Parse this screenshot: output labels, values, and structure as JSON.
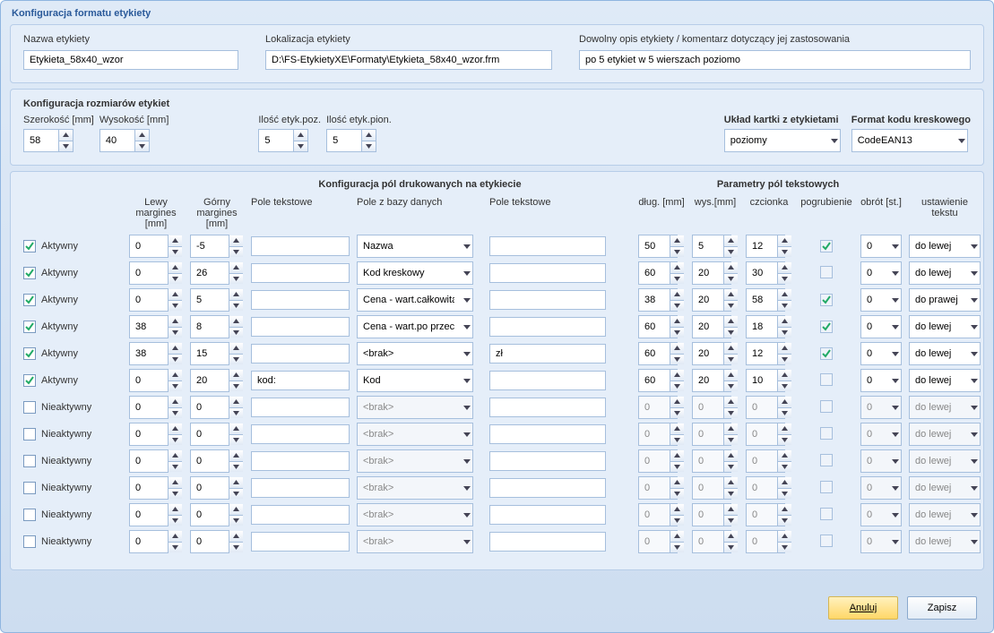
{
  "title": "Konfiguracja formatu etykiety",
  "top": {
    "name_label": "Nazwa etykiety",
    "name_value": "Etykieta_58x40_wzor",
    "loc_label": "Lokalizacja etykiety",
    "loc_value": "D:\\FS-EtykietyXE\\Formaty\\Etykieta_58x40_wzor.frm",
    "desc_label": "Dowolny opis etykiety / komentarz dotyczący jej zastosowania",
    "desc_value": "po 5 etykiet w 5 wierszach poziomo"
  },
  "sizes": {
    "section_title": "Konfiguracja rozmiarów etykiet",
    "width_label": "Szerokość [mm]",
    "width_value": "58",
    "height_label": "Wysokość [mm]",
    "height_value": "40",
    "count_h_label": "Ilość etyk.poz.",
    "count_h_value": "5",
    "count_v_label": "Ilość etyk.pion.",
    "count_v_value": "5",
    "layout_label": "Układ kartki z etykietami",
    "layout_value": "poziomy",
    "barcode_label": "Format kodu kreskowego",
    "barcode_value": "CodeEAN13"
  },
  "fields": {
    "mid_title": "Konfiguracja pól  drukowanych na etykiecie",
    "right_title": "Parametry pól tekstowych",
    "headers": {
      "empty": "",
      "left_margin": "Lewy margines [mm]",
      "top_margin": "Górny margines [mm]",
      "text_field": "Pole tekstowe",
      "db_field": "Pole z bazy danych",
      "text_field2": "Pole tekstowe",
      "length": "dług. [mm]",
      "height": "wys.[mm]",
      "font": "czcionka",
      "bold": "pogrubienie",
      "rotation": "obrót [st.]",
      "align": "ustawienie tekstu"
    },
    "active_label": "Aktywny",
    "inactive_label": "Nieaktywny",
    "rows": [
      {
        "active": true,
        "lm": "0",
        "tm": "-5",
        "t1": "",
        "db": "Nazwa",
        "t2": "",
        "len": "50",
        "h": "5",
        "font": "12",
        "bold": true,
        "rot": "0",
        "align": "do lewej"
      },
      {
        "active": true,
        "lm": "0",
        "tm": "26",
        "t1": "",
        "db": "Kod kreskowy",
        "t2": "",
        "len": "60",
        "h": "20",
        "font": "30",
        "bold": false,
        "rot": "0",
        "align": "do lewej"
      },
      {
        "active": true,
        "lm": "0",
        "tm": "5",
        "t1": "",
        "db": "Cena - wart.całkowita",
        "t2": "",
        "len": "38",
        "h": "20",
        "font": "58",
        "bold": true,
        "rot": "0",
        "align": "do prawej"
      },
      {
        "active": true,
        "lm": "38",
        "tm": "8",
        "t1": "",
        "db": "Cena - wart.po przecinku",
        "t2": "",
        "len": "60",
        "h": "20",
        "font": "18",
        "bold": true,
        "rot": "0",
        "align": "do lewej"
      },
      {
        "active": true,
        "lm": "38",
        "tm": "15",
        "t1": "",
        "db": "<brak>",
        "t2": "zł",
        "len": "60",
        "h": "20",
        "font": "12",
        "bold": true,
        "rot": "0",
        "align": "do lewej"
      },
      {
        "active": true,
        "lm": "0",
        "tm": "20",
        "t1": "kod:",
        "db": "Kod",
        "t2": "",
        "len": "60",
        "h": "20",
        "font": "10",
        "bold": false,
        "rot": "0",
        "align": "do lewej"
      },
      {
        "active": false,
        "lm": "0",
        "tm": "0",
        "t1": "",
        "db": "<brak>",
        "t2": "",
        "len": "0",
        "h": "0",
        "font": "0",
        "bold": false,
        "rot": "0",
        "align": "do lewej"
      },
      {
        "active": false,
        "lm": "0",
        "tm": "0",
        "t1": "",
        "db": "<brak>",
        "t2": "",
        "len": "0",
        "h": "0",
        "font": "0",
        "bold": false,
        "rot": "0",
        "align": "do lewej"
      },
      {
        "active": false,
        "lm": "0",
        "tm": "0",
        "t1": "",
        "db": "<brak>",
        "t2": "",
        "len": "0",
        "h": "0",
        "font": "0",
        "bold": false,
        "rot": "0",
        "align": "do lewej"
      },
      {
        "active": false,
        "lm": "0",
        "tm": "0",
        "t1": "",
        "db": "<brak>",
        "t2": "",
        "len": "0",
        "h": "0",
        "font": "0",
        "bold": false,
        "rot": "0",
        "align": "do lewej"
      },
      {
        "active": false,
        "lm": "0",
        "tm": "0",
        "t1": "",
        "db": "<brak>",
        "t2": "",
        "len": "0",
        "h": "0",
        "font": "0",
        "bold": false,
        "rot": "0",
        "align": "do lewej"
      },
      {
        "active": false,
        "lm": "0",
        "tm": "0",
        "t1": "",
        "db": "<brak>",
        "t2": "",
        "len": "0",
        "h": "0",
        "font": "0",
        "bold": false,
        "rot": "0",
        "align": "do lewej"
      }
    ]
  },
  "buttons": {
    "cancel": "Anuluj",
    "save": "Zapisz"
  }
}
